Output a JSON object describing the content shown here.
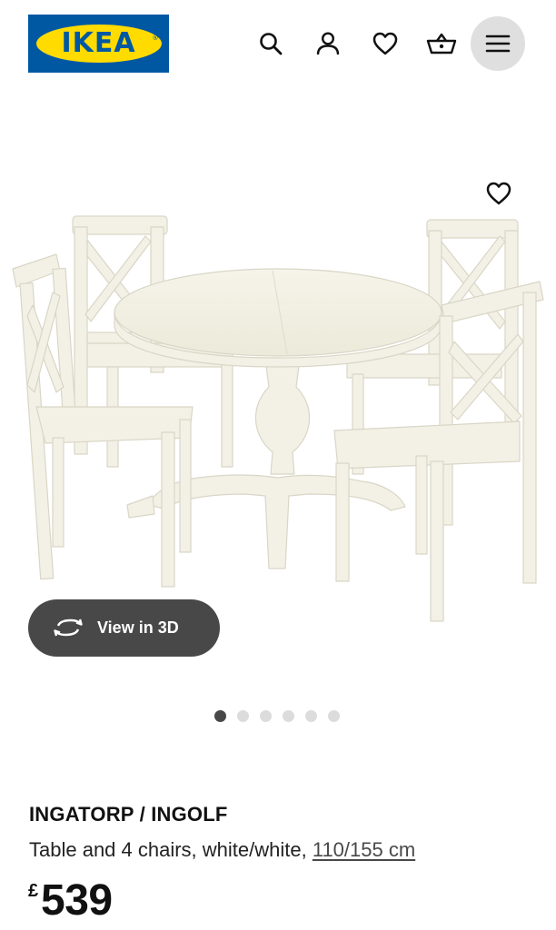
{
  "brand": {
    "logo_text": "IKEA",
    "logo_mark": "®",
    "colors": {
      "blue": "#0058a3",
      "yellow": "#ffdb00"
    }
  },
  "header": {
    "icons": [
      "search-icon",
      "account-icon",
      "favourites-icon",
      "basket-icon",
      "menu-icon"
    ]
  },
  "gallery": {
    "view_3d_label": "View in 3D",
    "image_count": 6,
    "active_image": 1
  },
  "product": {
    "name": "INGATORP / INGOLF",
    "description": "Table and 4 chairs, white/white, ",
    "size": "110/155 cm",
    "currency": "£",
    "price": "539"
  }
}
